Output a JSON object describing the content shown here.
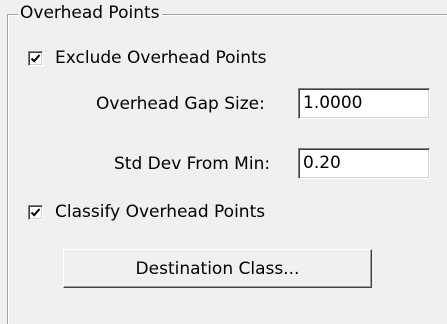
{
  "group": {
    "title": "Overhead Points"
  },
  "exclude_overhead": {
    "label": "Exclude Overhead Points",
    "checked": true
  },
  "gap_size": {
    "label": "Overhead Gap Size:",
    "value": "1.0000"
  },
  "std_dev": {
    "label": "Std Dev From Min:",
    "value": "0.20"
  },
  "classify_overhead": {
    "label": "Classify Overhead Points",
    "checked": true
  },
  "destination_button": {
    "label": "Destination Class..."
  }
}
